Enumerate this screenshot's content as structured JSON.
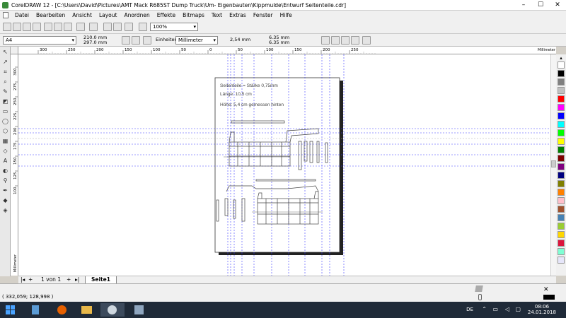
{
  "window": {
    "title": "CorelDRAW 12 - [C:\\Users\\David\\Pictures\\AMT Mack R685ST Dump Truck\\Um- Eigenbauten\\Kippmulde\\Entwurf Seitenteile.cdr]",
    "min": "–",
    "max": "☐",
    "close": "✕"
  },
  "menu": [
    "Datei",
    "Bearbeiten",
    "Ansicht",
    "Layout",
    "Anordnen",
    "Effekte",
    "Bitmaps",
    "Text",
    "Extras",
    "Fenster",
    "Hilfe"
  ],
  "toolbar": {
    "zoom": "100%"
  },
  "property_bar": {
    "page_size": "A4",
    "width": "210.0 mm",
    "height": "297.0 mm",
    "units_label": "Einheiten:",
    "units": "Millimeter",
    "nudge": "2,54 mm",
    "dup_x": "6.35 mm",
    "dup_y": "6.35 mm"
  },
  "rulers": {
    "h_ticks": [
      "300",
      "250",
      "200",
      "150",
      "100",
      "50",
      "0",
      "50",
      "100",
      "150",
      "200",
      "250"
    ],
    "h_unit": "Millimeter",
    "v_ticks": [
      "300",
      "275",
      "250",
      "225",
      "200",
      "175",
      "150",
      "125",
      "100"
    ],
    "v_unit": "Millimeter"
  },
  "document": {
    "line1": "Seitenteile = Stärke 0,75mm",
    "line2": "Länge: 10,5 cm",
    "line3": "Höhe: 5,4 cm gemessen hinten"
  },
  "pages": {
    "nav_first": "|◂",
    "nav_prev": "◂",
    "count": "1 von 1",
    "nav_next": "▸",
    "nav_last": "▸|",
    "add": "+",
    "tab": "Seite1"
  },
  "status": {
    "coords": "( 332,059; 128,998 )"
  },
  "taskbar": {
    "lang": "DE",
    "time": "08:06",
    "date": "24.01.2018"
  },
  "colors": {
    "guide": "#2a2aff",
    "palette": [
      "#ffffff",
      "#000000",
      "#808080",
      "#c0c0c0",
      "#ff0000",
      "#ff00ff",
      "#0000ff",
      "#00ffff",
      "#00ff00",
      "#ffff00",
      "#008000",
      "#800000",
      "#800080",
      "#000080",
      "#808000",
      "#ff8000",
      "#ffc0cb",
      "#a0522d",
      "#4682b4",
      "#9acd32",
      "#ffd700",
      "#dc143c",
      "#7fffd4",
      "#e6e6fa"
    ]
  }
}
